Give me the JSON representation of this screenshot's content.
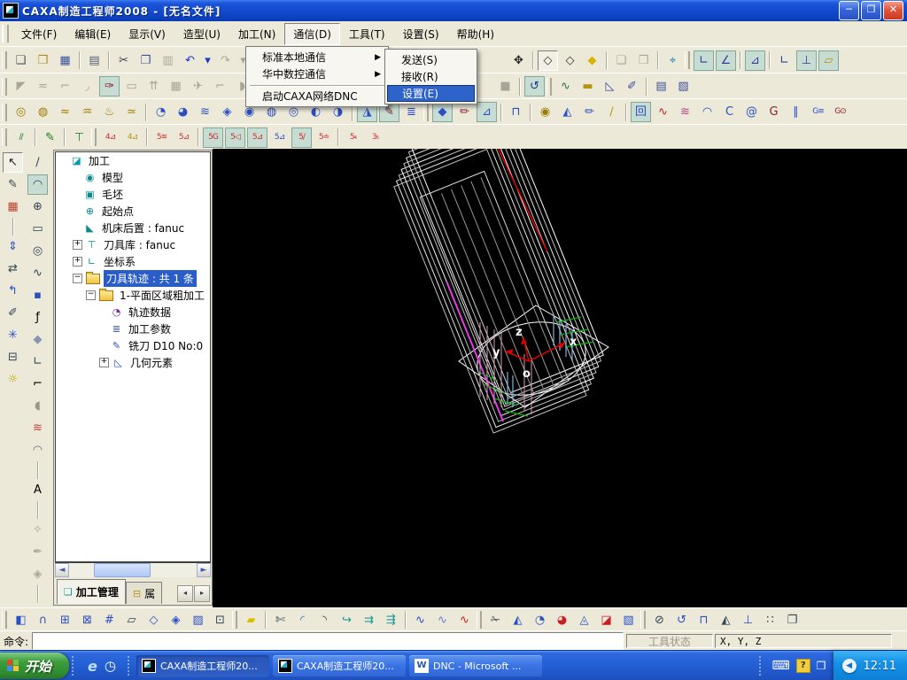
{
  "window": {
    "title": "CAXA制造工程师2008  -  [无名文件]",
    "controls": {
      "minimize": "─",
      "restore": "❐",
      "close": "✕"
    }
  },
  "menu_bar": {
    "items": [
      "文件(F)",
      "编辑(E)",
      "显示(V)",
      "造型(U)",
      "加工(N)",
      "通信(D)",
      "工具(T)",
      "设置(S)",
      "帮助(H)"
    ],
    "open_index": 5
  },
  "comm_menu": {
    "items": [
      {
        "label": "标准本地通信",
        "arrow": true
      },
      {
        "label": "华中数控通信",
        "arrow": true
      },
      {
        "sep": true
      },
      {
        "label": "启动CAXA网络DNC"
      }
    ]
  },
  "comm_submenu": {
    "items": [
      {
        "label": "发送(S)"
      },
      {
        "label": "接收(R)"
      },
      {
        "label": "设置(E)",
        "highlighted": true
      }
    ]
  },
  "toolbars": {
    "row1": [
      {
        "grip": 1
      },
      {
        "n": "new-file-icon",
        "g": "❏",
        "c": "#44515e"
      },
      {
        "n": "open-file-icon",
        "g": "❒",
        "c": "#b08820"
      },
      {
        "n": "save-file-icon",
        "g": "▦",
        "c": "#3a4e9c"
      },
      {
        "sep": 1
      },
      {
        "n": "print-icon",
        "g": "▤",
        "c": "#556070"
      },
      {
        "sep": 1
      },
      {
        "n": "cut-icon",
        "g": "✂",
        "c": "#334455"
      },
      {
        "n": "copy-icon",
        "g": "❐",
        "c": "#3a4e9c"
      },
      {
        "n": "paste-icon",
        "g": "▥",
        "d": 1
      },
      {
        "n": "undo-icon",
        "g": "↶",
        "c": "#1a3ac8"
      },
      {
        "n": "undo-dropdown-icon",
        "g": "▾",
        "c": "#1a3ac8",
        "w": 11
      },
      {
        "n": "redo-icon",
        "g": "↷",
        "d": 1
      },
      {
        "n": "redo-dropdown-icon",
        "g": "▾",
        "d": 1,
        "w": 11
      },
      {
        "sep": 1
      },
      {
        "n": "light-bulb-icon",
        "g": "☀",
        "c": "#d8b300"
      },
      {
        "gap": 258
      },
      {
        "n": "pan-view-icon",
        "g": "✥",
        "c": "#222"
      },
      {
        "sep": 1
      },
      {
        "n": "wireframe-display-icon",
        "g": "◇",
        "c": "#333",
        "press": 1
      },
      {
        "n": "hidden-line-display-icon",
        "g": "◇",
        "c": "#333"
      },
      {
        "n": "solid-display-icon",
        "g": "◆",
        "c": "#d8b300"
      },
      {
        "sep": 1
      },
      {
        "n": "group-icon",
        "g": "❏",
        "d": 1
      },
      {
        "n": "ungroup-icon",
        "g": "❐",
        "d": 1
      },
      {
        "sep": 1
      },
      {
        "n": "telescope-zoom-icon",
        "g": "⌖",
        "c": "#1a7ac0"
      },
      {
        "grip": 1
      },
      {
        "n": "coord-z-axis-icon",
        "g": "∟",
        "c": "#2a3f9e",
        "bg": 1
      },
      {
        "n": "coord-rotate-icon",
        "g": "∠",
        "c": "#2a3f9e",
        "bg": 1
      },
      {
        "sep": 1
      },
      {
        "n": "coord-plane-icon",
        "g": "⊿",
        "c": "#2a3f9e",
        "bg": 1
      },
      {
        "sep": 1
      },
      {
        "n": "axis-corner-icon",
        "g": "∟",
        "c": "#2a3f9e"
      },
      {
        "n": "axis-align-icon",
        "g": "⊥",
        "c": "#2a3f9e",
        "bg": 1
      },
      {
        "n": "work-plane-icon",
        "g": "▱",
        "c": "#b89410",
        "bg": 1
      }
    ],
    "row2": [
      {
        "grip": 1
      },
      {
        "n": "feature-tool-1-icon",
        "g": "◤",
        "d": 1
      },
      {
        "n": "feature-tool-2-icon",
        "g": "≂",
        "d": 1
      },
      {
        "n": "feature-tool-3-icon",
        "g": "⌐",
        "d": 1
      },
      {
        "n": "feature-tool-4-icon",
        "g": "◞",
        "d": 1
      },
      {
        "n": "sheet-update-icon",
        "g": "✑",
        "c": "#8a2030",
        "bg": 1
      },
      {
        "n": "feature-tool-5-icon",
        "g": "▭",
        "d": 1
      },
      {
        "n": "feature-tool-6-icon",
        "g": "⇈",
        "d": 1
      },
      {
        "n": "feature-tool-7-icon",
        "g": "▦",
        "d": 1
      },
      {
        "n": "feature-tool-8-icon",
        "g": "✈",
        "d": 1
      },
      {
        "n": "feature-tool-9-icon",
        "g": "⌐",
        "d": 1
      },
      {
        "n": "feature-tool-10-icon",
        "g": "◗",
        "d": 1
      },
      {
        "gap": 272
      },
      {
        "n": "blank-swatch-icon",
        "g": "■",
        "d": 1
      },
      {
        "sep": 1
      },
      {
        "n": "rotate-view-icon",
        "g": "↺",
        "c": "#1a3a8c",
        "bg": 1
      },
      {
        "grip": 1
      },
      {
        "n": "curve-analysis-icon",
        "g": "∿",
        "c": "#2a6f3e"
      },
      {
        "n": "ruler-icon",
        "g": "▬",
        "c": "#b89410"
      },
      {
        "n": "set-square-icon",
        "g": "◺",
        "c": "#3a4e9c"
      },
      {
        "n": "sketch-check-icon",
        "g": "✐",
        "c": "#3a4e9c"
      },
      {
        "sep": 1
      },
      {
        "n": "macro-doc-icon",
        "g": "▤",
        "c": "#3a4e9c"
      },
      {
        "n": "post-doc-icon",
        "g": "▧",
        "c": "#3a4e9c"
      }
    ],
    "row3": [
      {
        "grip": 1
      },
      {
        "n": "lathe-rough-icon",
        "g": "◎",
        "c": "#9a7d00"
      },
      {
        "n": "lathe-finish-icon",
        "g": "◍",
        "c": "#9a7d00"
      },
      {
        "n": "lathe-thread-icon",
        "g": "≈",
        "c": "#9a7d00"
      },
      {
        "n": "lathe-groove-icon",
        "g": "♒",
        "c": "#9a7d00"
      },
      {
        "n": "lathe-drill-icon",
        "g": "♨",
        "c": "#9a7d00"
      },
      {
        "n": "lathe-cutoff-icon",
        "g": "≃",
        "c": "#9a7d00"
      },
      {
        "sep": 1
      },
      {
        "n": "mill-rough-icon",
        "g": "◔",
        "c": "#2b4fc4"
      },
      {
        "n": "mill-contour-icon",
        "g": "◕",
        "c": "#2b4fc4"
      },
      {
        "n": "mill-zigzag-icon",
        "g": "≋",
        "c": "#2b4fc4"
      },
      {
        "n": "mill-pocket-icon",
        "g": "◈",
        "c": "#2b4fc4"
      },
      {
        "n": "mill-flowline-icon",
        "g": "◉",
        "c": "#2b4fc4"
      },
      {
        "n": "mill-drive-icon",
        "g": "◍",
        "c": "#2b4fc4"
      },
      {
        "n": "mill-spiral-icon",
        "g": "◎",
        "c": "#2b4fc4"
      },
      {
        "n": "mill-face-icon",
        "g": "◐",
        "c": "#2b4fc4"
      },
      {
        "n": "mill-radial-icon",
        "g": "◑",
        "c": "#2b4fc4"
      },
      {
        "sep": 1
      },
      {
        "n": "knife-path-icon",
        "g": "◮",
        "c": "#2b4fc4",
        "bg": 1
      },
      {
        "n": "pencil-check-icon",
        "g": "✎",
        "c": "#8a2030",
        "bg": 1
      },
      {
        "n": "layer-lines-icon",
        "g": "≣",
        "c": "#2b4fc4"
      },
      {
        "grip": 1
      },
      {
        "n": "mill-shell-icon",
        "g": "◆",
        "c": "#2b4fc4",
        "bg": 1
      },
      {
        "n": "engrave-icon",
        "g": "✏",
        "c": "#8a2030"
      },
      {
        "n": "chamfer-path-icon",
        "g": "⊿",
        "c": "#2b4fc4",
        "bg": 1
      },
      {
        "sep": 1
      },
      {
        "n": "tool-holder-icon",
        "g": "⊓",
        "c": "#2b4fc4"
      },
      {
        "sep": 1
      },
      {
        "n": "swirl-path-icon",
        "g": "◉",
        "c": "#9a7d00"
      },
      {
        "n": "tri-path-icon",
        "g": "◭",
        "c": "#2b4fc4"
      },
      {
        "n": "pencil-path-icon",
        "g": "✏",
        "c": "#2b4fc4"
      },
      {
        "n": "slope-path-icon",
        "g": "∕",
        "c": "#b89410"
      },
      {
        "sep": 1
      },
      {
        "n": "frame-spiral-icon",
        "g": "回",
        "c": "#2b4fc4",
        "bg": 1
      },
      {
        "n": "red-curve-icon",
        "g": "∿",
        "c": "#c82020"
      },
      {
        "n": "rainbow-lines-icon",
        "g": "≋",
        "c": "#b04090"
      },
      {
        "n": "shell-surface-icon",
        "g": "◠",
        "c": "#2b4fc4"
      },
      {
        "n": "c-cut-icon",
        "g": "C",
        "c": "#2b4fc4"
      },
      {
        "n": "snail-path-icon",
        "g": "@",
        "c": "#2b4fc4"
      },
      {
        "n": "g01-check-icon",
        "g": "G",
        "c": "#8a2030"
      },
      {
        "n": "multi-line-icon",
        "g": "∥",
        "c": "#2b4fc4"
      },
      {
        "n": "gcode-list-icon",
        "g": "G≡",
        "c": "#2b4fc4",
        "sm": 1
      },
      {
        "n": "gcode-run-icon",
        "g": "G⊙",
        "c": "#8a2030",
        "sm": 1
      }
    ],
    "row4": [
      {
        "grip": 1
      },
      {
        "n": "hatch-green-icon",
        "g": "∕∕",
        "c": "#1a7a1a",
        "sm": 1
      },
      {
        "sep": 1
      },
      {
        "n": "pen-green-icon",
        "g": "✎",
        "c": "#1a7a1a"
      },
      {
        "sep": 1
      },
      {
        "n": "tool-tee-icon",
        "g": "⊤",
        "c": "#1a7a1a"
      },
      {
        "grip": 1
      },
      {
        "n": "axis4-curve-icon",
        "g": "4⊿",
        "c": "#c83030",
        "sm": 1
      },
      {
        "n": "axis4-plane-icon",
        "g": "4⊿",
        "c": "#b89410",
        "sm": 1
      },
      {
        "sep": 1
      },
      {
        "n": "axis5-lines-icon",
        "g": "5≋",
        "c": "#c83030",
        "sm": 1
      },
      {
        "n": "axis5-tri-icon",
        "g": "5⊿",
        "c": "#c83030",
        "sm": 1
      },
      {
        "sep": 1
      },
      {
        "n": "axis5-g-icon",
        "g": "5G",
        "c": "#c83030",
        "sm": 1,
        "bg": 1
      },
      {
        "n": "axis5-left-icon",
        "g": "5◁",
        "c": "#c83030",
        "sm": 1,
        "bg": 1
      },
      {
        "n": "axis5-swarf-icon",
        "g": "5⊿",
        "c": "#c83030",
        "sm": 1,
        "bg": 1
      },
      {
        "n": "axis5-curve-icon",
        "g": "5⊿",
        "c": "#2b4fc4",
        "sm": 1
      },
      {
        "n": "axis5-slant-icon",
        "g": "5∕",
        "c": "#c83030",
        "sm": 1,
        "bg": 1
      },
      {
        "n": "axis5-limit-icon",
        "g": "5≐",
        "c": "#c83030",
        "sm": 1
      },
      {
        "sep": 1
      },
      {
        "n": "axis5to4-icon",
        "g": "5₄",
        "c": "#c83030",
        "sm": 1
      },
      {
        "n": "axis3to5-icon",
        "g": "3₅",
        "c": "#c83030",
        "sm": 1
      }
    ],
    "bottom": [
      {
        "grip": 1
      },
      {
        "n": "surface-page-icon",
        "g": "◧",
        "c": "#2b4fc4"
      },
      {
        "n": "bell-surface-icon",
        "g": "∩",
        "c": "#2b4fc4"
      },
      {
        "n": "fplus-box-icon",
        "g": "⊞",
        "c": "#2b4fc4"
      },
      {
        "n": "fplus-tri-icon",
        "g": "⊠",
        "c": "#2b4fc4"
      },
      {
        "n": "frame-pair-icon",
        "g": "#",
        "c": "#2b4fc4"
      },
      {
        "n": "plane-icon",
        "g": "▱",
        "c": "#334455"
      },
      {
        "n": "diamond-surface-icon",
        "g": "◇",
        "c": "#2b4fc4"
      },
      {
        "n": "diamond-fold-icon",
        "g": "◈",
        "c": "#2b4fc4"
      },
      {
        "n": "diamond-hatch-icon",
        "g": "▨",
        "c": "#2b4fc4"
      },
      {
        "n": "dashed-cube-icon",
        "g": "⊡",
        "c": "#334455"
      },
      {
        "grip": 1
      },
      {
        "n": "eraser-icon",
        "g": "▰",
        "c": "#d8c000"
      },
      {
        "sep": 1
      },
      {
        "n": "trim-scissors-icon",
        "g": "✄",
        "c": "#334455"
      },
      {
        "n": "fillet-icon",
        "g": "◜",
        "c": "#1a7ac0"
      },
      {
        "n": "fillet-corner-icon",
        "g": "◝",
        "c": "#334455"
      },
      {
        "n": "extend-arrow-icon",
        "g": "↪",
        "c": "#1a9a9a"
      },
      {
        "n": "offset-arrow-icon",
        "g": "⇉",
        "c": "#1a9a9a"
      },
      {
        "n": "array-arrow-icon",
        "g": "⇶",
        "c": "#1a9a9a"
      },
      {
        "sep": 1
      },
      {
        "n": "curve-blue-icon",
        "g": "∿",
        "c": "#2b4fc4"
      },
      {
        "n": "curve-blue2-icon",
        "g": "∿",
        "c": "#6a7fd4"
      },
      {
        "n": "curve-red-icon",
        "g": "∿",
        "c": "#c82020"
      },
      {
        "grip": 1
      },
      {
        "n": "surface-trim-icon",
        "g": "✁",
        "c": "#334455"
      },
      {
        "n": "surface-fold-icon",
        "g": "◭",
        "c": "#2b4fc4"
      },
      {
        "n": "surface-fan-icon",
        "g": "◔",
        "c": "#2b4fc4"
      },
      {
        "n": "surface-fan-red-icon",
        "g": "◕",
        "c": "#c82020"
      },
      {
        "n": "surface-cone-icon",
        "g": "◬",
        "c": "#2b4fc4"
      },
      {
        "n": "surface-cut-icon",
        "g": "◪",
        "c": "#c82020"
      },
      {
        "n": "surface-hatch-icon",
        "g": "▧",
        "c": "#2b4fc4"
      },
      {
        "grip": 1
      },
      {
        "n": "circle-trim-icon",
        "g": "⊘",
        "c": "#334455"
      },
      {
        "n": "rotate-bell-icon",
        "g": "↺",
        "c": "#2b4fc4"
      },
      {
        "n": "bell-front-icon",
        "g": "⊓",
        "c": "#2b4fc4"
      },
      {
        "n": "mirror-icon",
        "g": "◭",
        "c": "#334455"
      },
      {
        "n": "bell-axis-icon",
        "g": "⊥",
        "c": "#2b4fc4"
      },
      {
        "n": "array-grid-icon",
        "g": "∷",
        "c": "#334455"
      },
      {
        "n": "plane-copy-icon",
        "g": "❐",
        "c": "#334455"
      }
    ],
    "col1": [
      {
        "n": "select-pointer-icon",
        "g": "↖",
        "c": "#222",
        "press": 1
      },
      {
        "n": "sketch-pen-icon",
        "g": "✎",
        "c": "#334455"
      },
      {
        "n": "bitmap-image-icon",
        "g": "▦",
        "c": "#c04030"
      },
      {
        "sep": 1
      },
      {
        "n": "dimension-edit-icon",
        "g": "⇕",
        "c": "#2b4fc4"
      },
      {
        "n": "box-edit-icon",
        "g": "⇄",
        "c": "#334455"
      },
      {
        "n": "corner-arrow-icon",
        "g": "↰",
        "c": "#2b4fc4"
      },
      {
        "n": "corner-pen-icon",
        "g": "✐",
        "c": "#334455"
      },
      {
        "n": "construction-lines-icon",
        "g": "✳",
        "c": "#2b4fc4"
      },
      {
        "n": "drawer-icon",
        "g": "⊟",
        "c": "#334455"
      },
      {
        "n": "options-bulb-icon",
        "g": "☼",
        "c": "#c8a000"
      }
    ],
    "col2": [
      {
        "n": "line-icon",
        "g": "∕",
        "c": "#334455"
      },
      {
        "n": "arc-icon",
        "g": "◠",
        "c": "#334455",
        "bg": 1
      },
      {
        "n": "circle-icon",
        "g": "⊕",
        "c": "#334455"
      },
      {
        "n": "rectangle-icon",
        "g": "▭",
        "c": "#334455"
      },
      {
        "n": "ellipse-icon",
        "g": "◎",
        "c": "#334455"
      },
      {
        "n": "spline-icon",
        "g": "∿",
        "c": "#334455"
      },
      {
        "n": "point-icon",
        "g": "▪",
        "c": "#2b4fc4"
      },
      {
        "n": "formula-curve-icon",
        "g": "ƒ",
        "c": "#000"
      },
      {
        "n": "polygon-icon",
        "g": "◆",
        "c": "#8a96b0"
      },
      {
        "n": "local-axis-icon",
        "g": "∟",
        "c": "#334455"
      },
      {
        "n": "projection-icon",
        "g": "⌐",
        "c": "#000"
      },
      {
        "n": "surface-blob-icon",
        "g": "◖",
        "c": "#9a9789"
      },
      {
        "n": "ruled-surface-icon",
        "g": "≋",
        "c": "#c04040"
      },
      {
        "n": "revolve-surface-icon",
        "g": "◠",
        "c": "#6a7080"
      },
      {
        "sep": 1
      },
      {
        "n": "text-icon",
        "g": "A",
        "c": "#000"
      },
      {
        "sep": 1
      },
      {
        "n": "dim-linear-icon",
        "g": "✧",
        "d": 1
      },
      {
        "n": "dim-pen-icon",
        "g": "✒",
        "d": 1
      },
      {
        "n": "dim-angle-icon",
        "g": "◈",
        "d": 1
      },
      {
        "sep": 1
      },
      {
        "n": "fill-bucket-icon",
        "g": "⊔",
        "c": "#9a9789"
      }
    ]
  },
  "tree": {
    "rows": [
      {
        "label": "加工",
        "lv": 0,
        "ico": "part-root",
        "g": "◪",
        "c": "#0a9aaa"
      },
      {
        "label": "模型",
        "lv": 1,
        "ico": "model",
        "g": "◉",
        "c": "#0a8a8a"
      },
      {
        "label": "毛坯",
        "lv": 1,
        "ico": "blank-stock",
        "g": "▣",
        "c": "#0a8a8a"
      },
      {
        "label": "起始点",
        "lv": 1,
        "ico": "start-point",
        "g": "⊕",
        "c": "#0a8a8a"
      },
      {
        "label": "机床后置 : fanuc",
        "lv": 1,
        "ico": "machine-post",
        "g": "◣",
        "c": "#0a8a8a"
      },
      {
        "label": "刀具库 : fanuc",
        "lv": 1,
        "ico": "tool-library",
        "g": "⊤",
        "c": "#0a8a8a",
        "exp": "+"
      },
      {
        "label": "坐标系",
        "lv": 1,
        "ico": "coordinate-system",
        "g": "∟",
        "c": "#0a8a8a",
        "exp": "+"
      },
      {
        "label": "刀具轨迹 : 共 1 条",
        "lv": 1,
        "ico": "folder",
        "exp": "-",
        "sel": true
      },
      {
        "label": "1-平面区域粗加工",
        "lv": 2,
        "ico": "folder",
        "exp": "-"
      },
      {
        "label": "轨迹数据",
        "lv": 3,
        "ico": "trajectory-data",
        "g": "◔",
        "c": "#7a2a9a"
      },
      {
        "label": "加工参数",
        "lv": 3,
        "ico": "machining-params",
        "g": "≣",
        "c": "#2b4fc4"
      },
      {
        "label": "铣刀 D10 No:0",
        "lv": 3,
        "ico": "mill-cutter",
        "g": "✎",
        "c": "#2b4fc4"
      },
      {
        "label": "几何元素",
        "lv": 3,
        "ico": "geometry-elements",
        "g": "◺",
        "c": "#2b4fc4",
        "exp": "+"
      }
    ]
  },
  "panel_tabs": {
    "tabs": [
      {
        "label": "加工管理",
        "active": true
      },
      {
        "label": "属"
      }
    ]
  },
  "viewport": {
    "axes": {
      "x": "x",
      "y": "y",
      "z": "z",
      "o": "o"
    }
  },
  "command": {
    "label": "命令:",
    "value": ""
  },
  "status": {
    "tool_status": "工具状态",
    "coords": "X, Y, Z"
  },
  "taskbar": {
    "start_label": "开始",
    "quick_launch": [
      "internet-explorer-icon",
      "scheduler-icon"
    ],
    "buttons": [
      {
        "title": "CAXA制造工程师20...",
        "app": "caxa",
        "pressed": true
      },
      {
        "title": "CAXA制造工程师20...",
        "app": "caxa"
      },
      {
        "title": "DNC - Microsoft ...",
        "app": "word"
      }
    ],
    "clock": "12:11"
  }
}
